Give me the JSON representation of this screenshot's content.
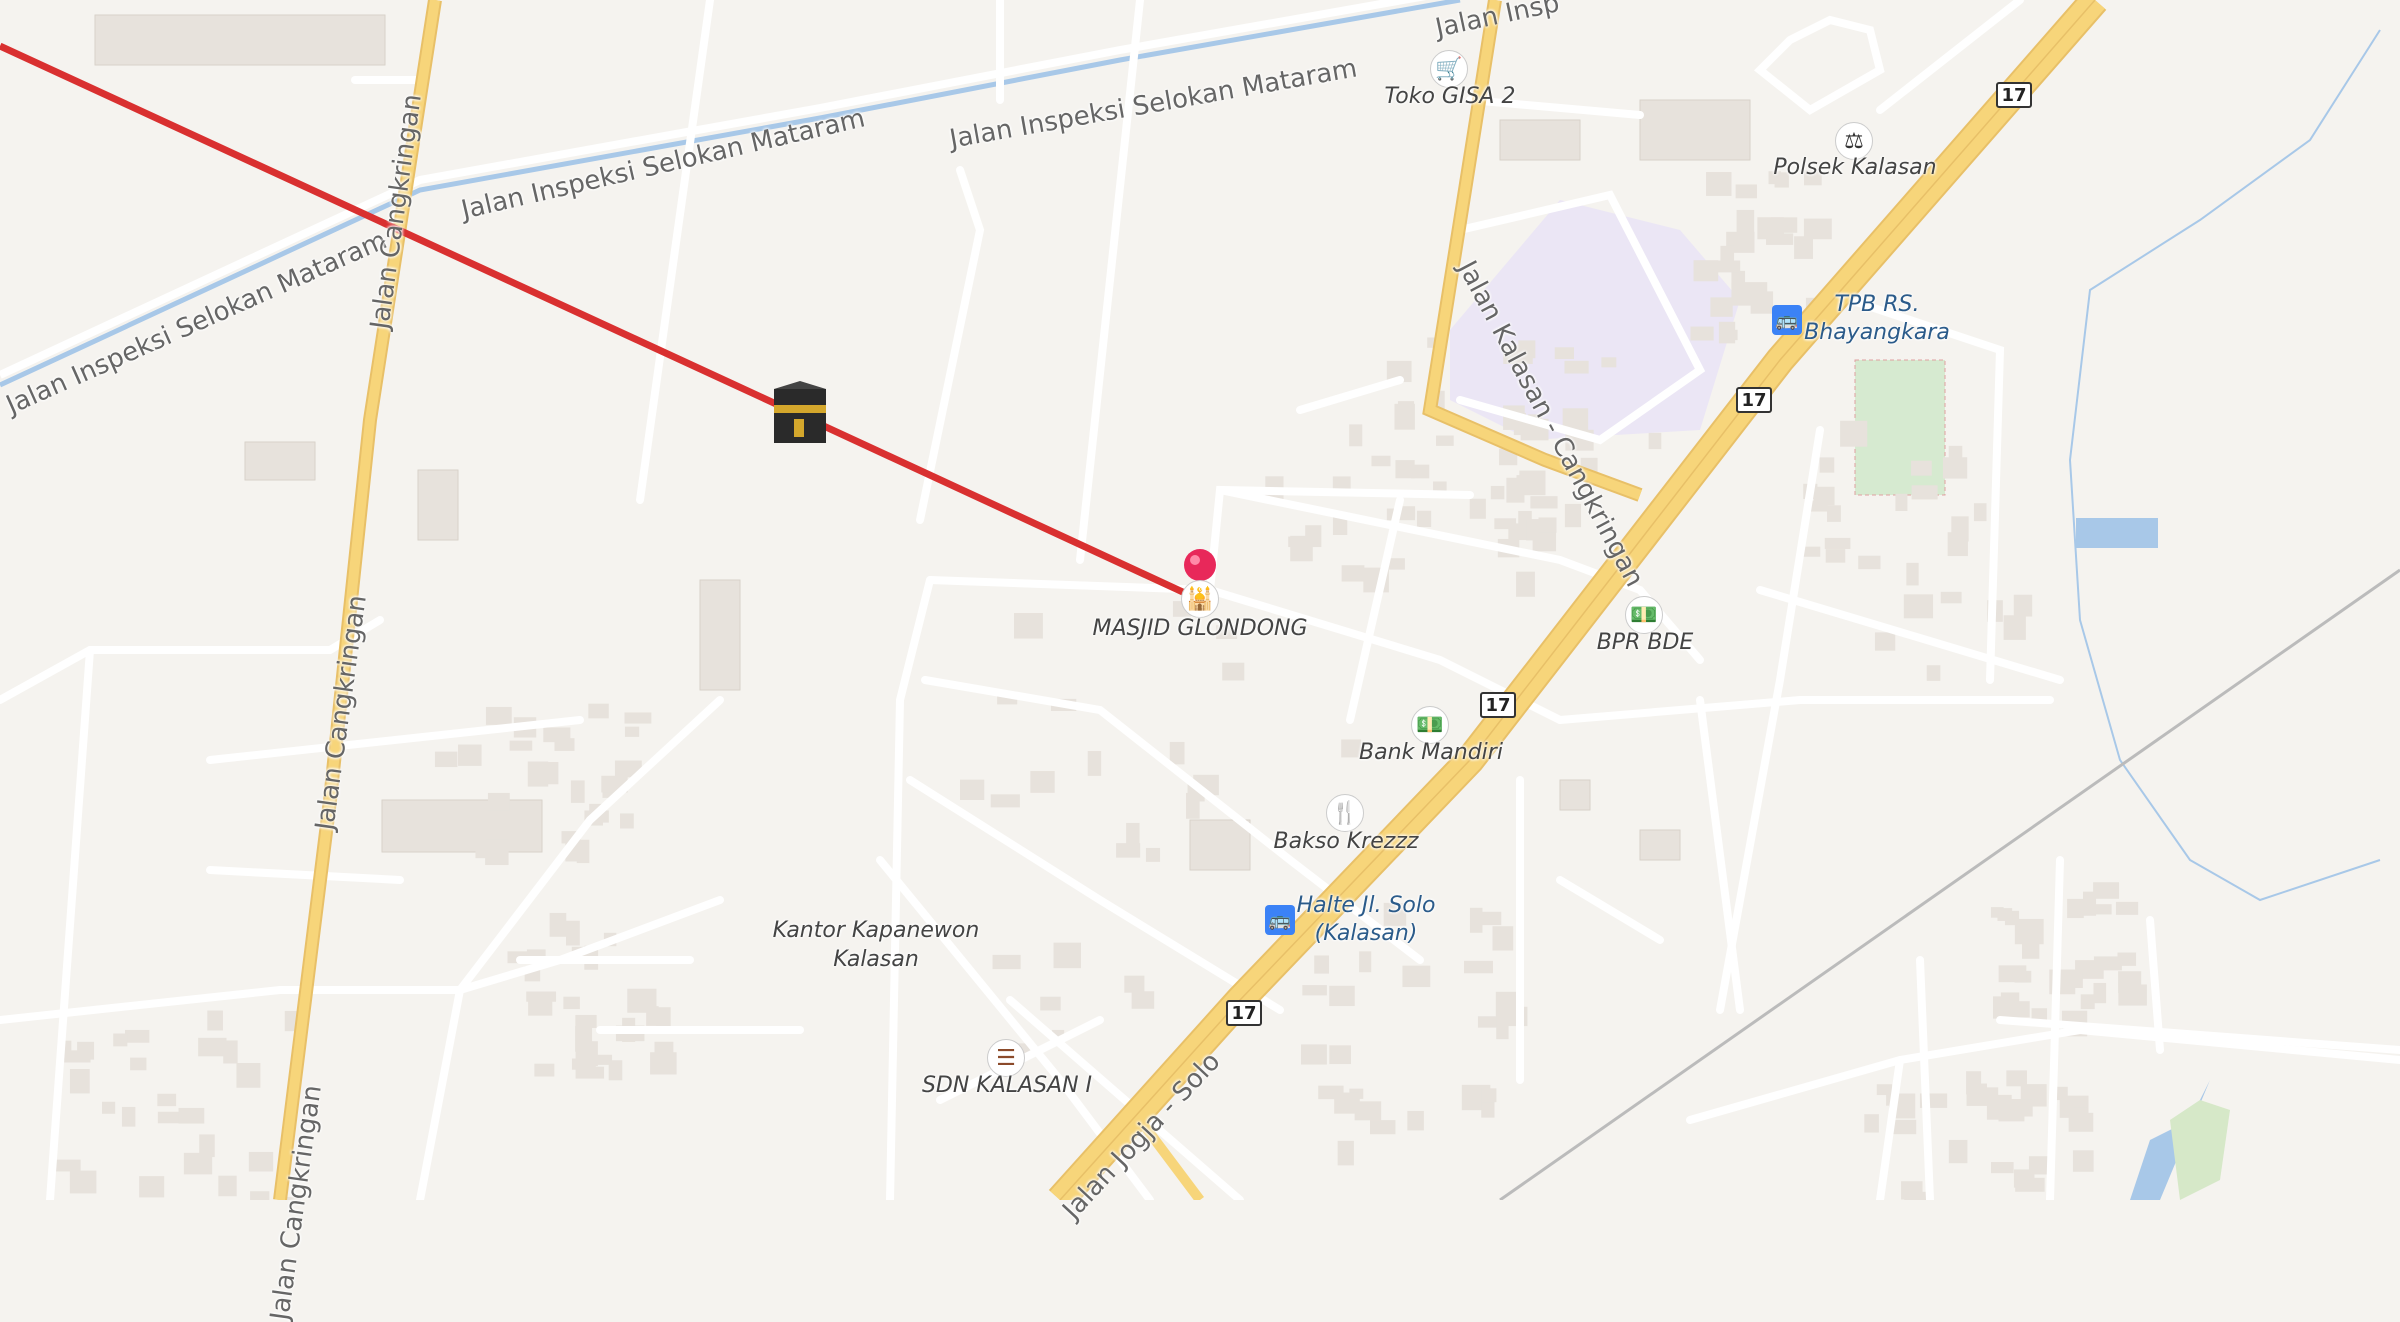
{
  "map": {
    "background": "#f5f3ef",
    "road_color": "#ffffff",
    "main_road_color": "#f7d57a",
    "route_color": "#d93030",
    "water_color": "#a8c8e8",
    "building_color": "#e7e2dc"
  },
  "road_labels": {
    "selokan_left": "Jalan Inspeksi Selokan Mataram",
    "selokan_mid": "Jalan Inspeksi Selokan Mataram",
    "selokan_right": "Jalan Inspeksi Selokan Mataram",
    "selokan_top": "Jalan Insp",
    "cangkringan_top": "Jalan Cangkringan",
    "cangkringan_mid": "Jalan Cangkringan",
    "cangkringan_bottom": "Jalan Cangkringan",
    "kalasan_cangkringan": "Jalan Kalasan - Cangkringan",
    "jogja_solo": "Jalan Jogja - Solo"
  },
  "route_shields": [
    "17",
    "17",
    "17",
    "17"
  ],
  "pois": {
    "toko_gisa": "Toko GISA 2",
    "polsek": "Polsek Kalasan",
    "tpb_rs": "TPB RS.",
    "tpb_rs_2": "Bhayangkara",
    "masjid": "MASJID GLONDONG",
    "bpr": "BPR BDE",
    "bank_mandiri": "Bank Mandiri",
    "bakso": "Bakso Krezzz",
    "halte_1": "Halte Jl. Solo",
    "halte_2": "(Kalasan)",
    "kantor_1": "Kantor Kapanewon",
    "kantor_2": "Kalasan",
    "sdn": "SDN KALASAN I"
  },
  "icons": {
    "shop": "shopping-basket-icon",
    "police": "police-icon",
    "bus": "bus-stop-icon",
    "mosque": "mosque-icon",
    "bank": "bank-icon",
    "food": "restaurant-icon",
    "school": "school-icon",
    "kaaba": "kaaba-icon",
    "pin": "location-pin-icon"
  }
}
